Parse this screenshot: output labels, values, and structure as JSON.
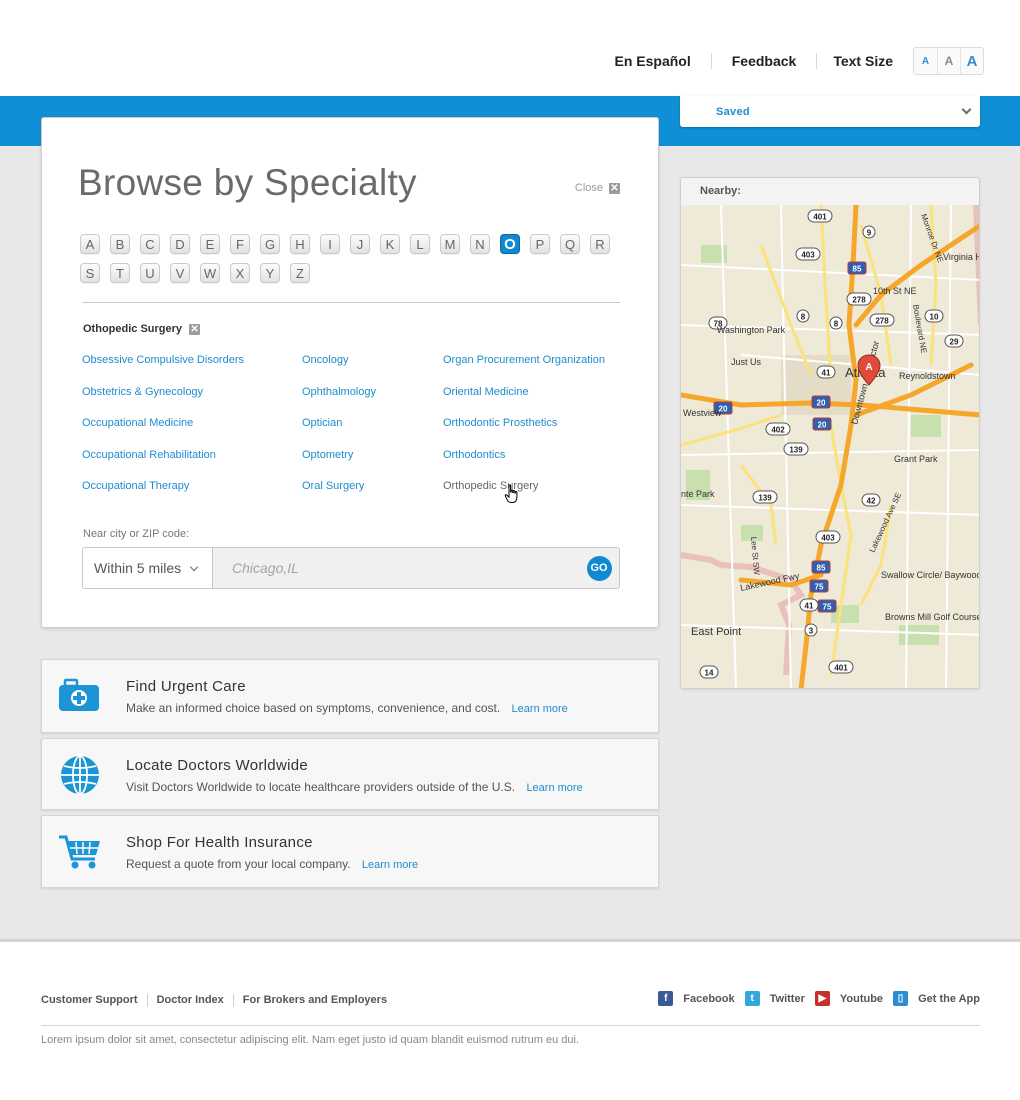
{
  "header": {
    "links": [
      "En Español",
      "Feedback"
    ],
    "text_size_label": "Text Size",
    "text_size_options": [
      "A",
      "A",
      "A"
    ]
  },
  "saved": {
    "label": "Saved"
  },
  "browse": {
    "title": "Browse by Specialty",
    "close_label": "Close",
    "close_x": "✕",
    "letters": [
      "A",
      "B",
      "C",
      "D",
      "E",
      "F",
      "G",
      "H",
      "I",
      "J",
      "K",
      "L",
      "M",
      "N",
      "O",
      "P",
      "Q",
      "R",
      "S",
      "T",
      "U",
      "V",
      "W",
      "X",
      "Y",
      "Z"
    ],
    "active_letter": "O",
    "selected_specialty": "Othopedic Surgery",
    "specialties": {
      "col1": [
        "Obsessive Compulsive Disorders",
        "Obstetrics & Gynecology",
        "Occupational Medicine",
        "Occupational Rehabilitation",
        "Occupational Therapy"
      ],
      "col2": [
        "Oncology",
        "Ophthalmology",
        "Optician",
        "Optometry",
        "Oral Surgery"
      ],
      "col3": [
        "Organ Procurement Organization",
        "Oriental Medicine",
        "Orthodontic Prosthetics",
        "Orthodontics",
        "Orthopedic Surgery"
      ]
    },
    "near_label": "Near city or ZIP code:",
    "radius_value": "Within 5 miles",
    "location_placeholder": "Chicago,IL",
    "go_label": "GO"
  },
  "nearby": {
    "label": "Nearby:",
    "map": {
      "city_marker": "A",
      "places": [
        "Atlanta",
        "Washington Park",
        "Just Us",
        "Westview",
        "Reynoldstown",
        "Grant Park",
        "Swallow Circle/ Baywood",
        "Browns Mill Golf Course",
        "East Point",
        "Virginia Highland",
        "10th St NE",
        "Lakewood Fwy",
        "Downtown Connector",
        "Lee St SW",
        "Lakewood Ave SE",
        "Boulevard NE",
        "Monroe Dr NE",
        "nte Park"
      ],
      "road_shields": [
        "401",
        "9",
        "403",
        "85",
        "278",
        "78",
        "8",
        "8",
        "278",
        "10",
        "29",
        "41",
        "20",
        "20",
        "402",
        "20",
        "139",
        "42",
        "139",
        "403",
        "85",
        "75",
        "41",
        "75",
        "3",
        "401",
        "14"
      ]
    }
  },
  "features": [
    {
      "title": "Find Urgent Care",
      "desc": "Make an informed choice based on symptoms, convenience, and cost.",
      "link": "Learn more",
      "icon": "first-aid-kit-icon"
    },
    {
      "title": "Locate Doctors Worldwide",
      "desc": "Visit Doctors Worldwide to locate healthcare providers outside of the U.S.",
      "link": "Learn more",
      "icon": "globe-icon"
    },
    {
      "title": "Shop For Health Insurance",
      "desc": "Request a quote from your local company.",
      "link": "Learn more",
      "icon": "shopping-cart-icon"
    }
  ],
  "footer": {
    "links": [
      "Customer Support",
      "Doctor Index",
      "For Brokers and Employers"
    ],
    "social": [
      {
        "label": "Facebook",
        "icon": "facebook-icon",
        "glyph": "f",
        "color": "#3b5998"
      },
      {
        "label": "Twitter",
        "icon": "twitter-icon",
        "glyph": "t",
        "color": "#33a7d9"
      },
      {
        "label": "Youtube",
        "icon": "youtube-icon",
        "glyph": "▶",
        "color": "#c4302b"
      },
      {
        "label": "Get the App",
        "icon": "mobile-app-icon",
        "glyph": "▯",
        "color": "#2a8fd2"
      }
    ],
    "legal": "Lorem ipsum dolor sit amet, consectetur adipiscing elit. Nam eget justo id quam blandit euismod rutrum eu dui."
  },
  "colors": {
    "brand_blue": "#0f8fd5",
    "link_blue": "#1d8ccf",
    "page_grey": "#e8e8e8"
  }
}
